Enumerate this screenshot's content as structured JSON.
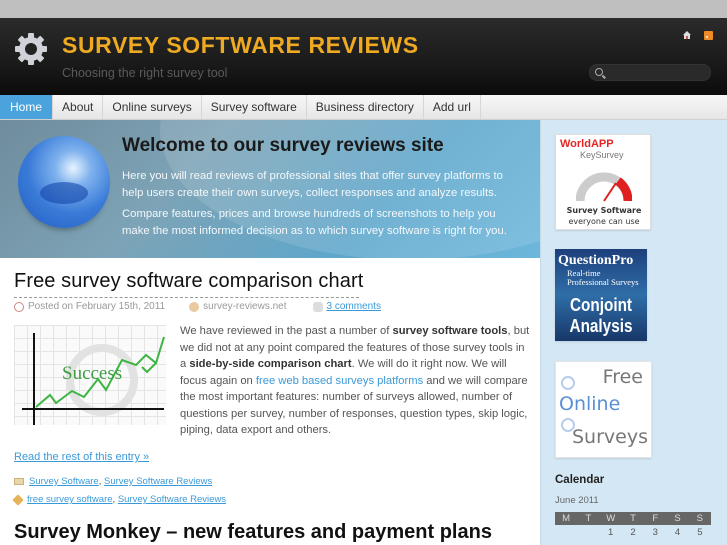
{
  "header": {
    "site_title": "SURVEY SOFTWARE REVIEWS",
    "tagline": "Choosing the right survey tool",
    "search_placeholder": "",
    "icons": [
      "gear-icon",
      "home-icon",
      "rss-icon",
      "search-icon"
    ]
  },
  "nav": {
    "items": [
      {
        "label": "Home",
        "active": true
      },
      {
        "label": "About"
      },
      {
        "label": "Online surveys"
      },
      {
        "label": "Survey software"
      },
      {
        "label": "Business directory"
      },
      {
        "label": "Add url"
      }
    ]
  },
  "hero": {
    "title": "Welcome to our survey reviews site",
    "paragraph1": "Here you will read reviews of professional sites that offer survey platforms to help users create their own surveys, collect responses and analyze results.",
    "paragraph2": "Compare features, prices and browse hundreds of screenshots to help you make the most informed decision as to which survey software is right for you."
  },
  "posts": [
    {
      "title": "Free survey software comparison chart",
      "posted_on": "Posted on February 15th, 2011",
      "author": "survey-reviews.net",
      "comments": "3 comments",
      "thumbnail_text": "Success",
      "body": {
        "t1": "We have reviewed in the past a number of ",
        "b1": "survey software tools",
        "t2": ", but we did not at any point compared the features of those survey tools in a ",
        "b2": "side-by-side comparison chart",
        "t3": ". We will do it right now. We will focus again on ",
        "link": "free web based surveys platforms",
        "t4": " and we will compare the most important features: number of surveys allowed, number of questions per survey, number of responses, question types, skip logic, piping, data export and others."
      },
      "read_more": "Read the rest of this entry »",
      "categories": [
        "Survey Software",
        "Survey Software Reviews"
      ],
      "tags": [
        "free survey software",
        "Survey Software Reviews"
      ]
    },
    {
      "title": "Survey Monkey – new features and payment plans"
    }
  ],
  "sidebar": {
    "ads": [
      {
        "brand": "WorldAPP",
        "sub": "KeySurvey",
        "line1": "Survey Software",
        "line2": "everyone can use"
      },
      {
        "brand": "QuestionPro",
        "sub1": "Real-time",
        "sub2": "Professional Surveys",
        "line1": "Conjoint",
        "line2": "Analysis"
      },
      {
        "word1": "Free",
        "word2": "Online",
        "word3": "Surveys"
      }
    ],
    "calendar": {
      "title": "Calendar",
      "month": "June 2011",
      "weekdays": [
        "M",
        "T",
        "W",
        "T",
        "F",
        "S",
        "S"
      ],
      "first_row": [
        "",
        "",
        "1",
        "2",
        "3",
        "4",
        "5"
      ]
    }
  },
  "colors": {
    "title_accent": "#eeaa22",
    "nav_active": "#4aa3dc",
    "link": "#3a9ad9",
    "sidebar_bg": "#d4e7f5"
  }
}
